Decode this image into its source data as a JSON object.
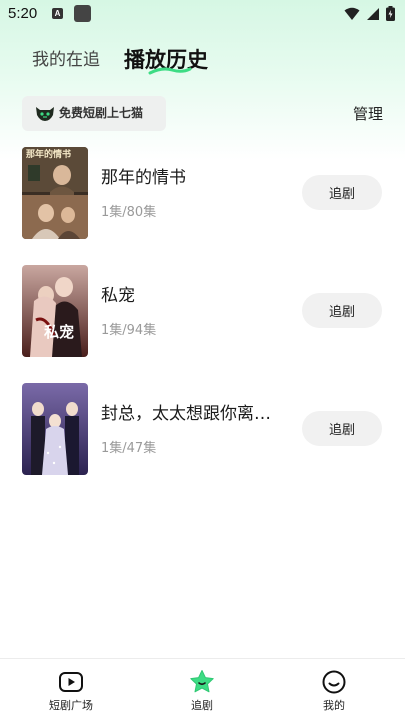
{
  "status_bar": {
    "time": "5:20",
    "notification_letter": "A"
  },
  "tabs": [
    {
      "label": "我的在追",
      "active": false
    },
    {
      "label": "播放历史",
      "active": true
    }
  ],
  "promo": {
    "text": "免费短剧上七猫"
  },
  "manage_label": "管理",
  "history": [
    {
      "title": "那年的情书",
      "progress": "1集/80集",
      "button": "追剧",
      "cover_text": "那年的情书"
    },
    {
      "title": "私宠",
      "progress": "1集/94集",
      "button": "追剧",
      "cover_text": "私宠"
    },
    {
      "title": "封总，太太想跟你离…",
      "progress": "1集/47集",
      "button": "追剧",
      "cover_text": ""
    }
  ],
  "bottom_nav": [
    {
      "label": "短剧广场",
      "icon": "play-icon",
      "active": false
    },
    {
      "label": "追剧",
      "icon": "star-icon",
      "active": true
    },
    {
      "label": "我的",
      "icon": "smile-icon",
      "active": false
    }
  ],
  "colors": {
    "accent_green": "#3ddc84",
    "header_gradient_top": "#d6f7e4",
    "button_bg": "#f1f1f1"
  }
}
